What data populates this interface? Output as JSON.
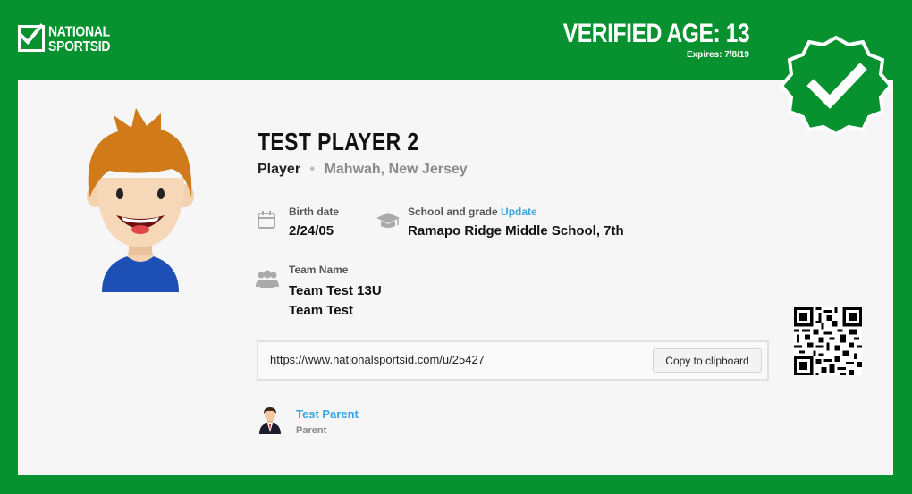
{
  "brand": {
    "line1": "NATIONAL",
    "line2": "SPORTSID",
    "logo_icon": "checkbox-check-icon"
  },
  "verification": {
    "age_label": "VERIFIED AGE: 13",
    "expires": "Expires: 7/8/19",
    "badge_icon": "verified-check-badge-icon"
  },
  "player": {
    "name": "TEST PLAYER 2",
    "role": "Player",
    "separator": "•",
    "location": "Mahwah, New Jersey"
  },
  "birth": {
    "label": "Birth date",
    "value": "2/24/05",
    "icon": "calendar-icon"
  },
  "school": {
    "label": "School and grade",
    "update_link": "Update",
    "value": "Ramapo Ridge Middle School, 7th",
    "icon": "graduation-cap-icon"
  },
  "team": {
    "label": "Team Name",
    "line1": "Team Test 13U",
    "line2": "Team Test",
    "icon": "group-icon"
  },
  "profile_link": {
    "url": "https://www.nationalsportsid.com/u/25427",
    "copy_label": "Copy to clipboard"
  },
  "parent": {
    "name": "Test Parent",
    "role": "Parent"
  },
  "colors": {
    "brand_green": "#08912f",
    "link_blue": "#3aa5e0",
    "card_bg": "#f6f6f6"
  }
}
